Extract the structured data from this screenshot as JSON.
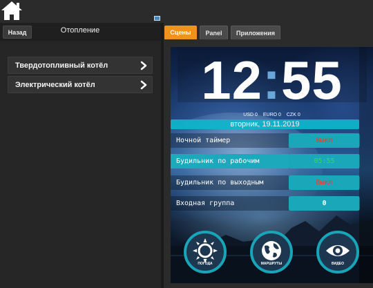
{
  "header": {
    "home_icon": "home-icon"
  },
  "left": {
    "back_label": "Назад",
    "title": "Отопление",
    "items": [
      {
        "label": "Твердотопливный котёл"
      },
      {
        "label": "Электрический котёл"
      }
    ]
  },
  "tabs": [
    {
      "label": "Сцены",
      "active": true
    },
    {
      "label": "Panel",
      "active": false
    },
    {
      "label": "Приложения",
      "active": false
    }
  ],
  "scene": {
    "clock_hours": "12",
    "clock_sep": ":",
    "clock_minutes": "55",
    "currency": {
      "usd": "USD 0",
      "euro": "EURO 0",
      "czk": "CZK 0"
    },
    "date": "вторник, 19.11.2019",
    "rows": [
      {
        "label": "Ночной таймер",
        "value": "Выкл",
        "value_color": "#e33d3d"
      },
      {
        "label": "Будильник по рабочим",
        "value": "05:55",
        "value_color": "#3ddc3d"
      },
      {
        "label": "Будильник по выходным",
        "value": "Выкл",
        "value_color": "#e33d3d"
      },
      {
        "label": "Входная группа",
        "value": "0",
        "value_color": "#ffffff"
      }
    ],
    "buttons": [
      {
        "label": "ПОГОДА",
        "icon": "sun-icon"
      },
      {
        "label": "МАРШРУТЫ",
        "icon": "globe-icon"
      },
      {
        "label": "ВИДЕО",
        "icon": "eye-icon"
      }
    ]
  },
  "colors": {
    "accent": "#f0921c",
    "teal": "#19a7b9"
  }
}
